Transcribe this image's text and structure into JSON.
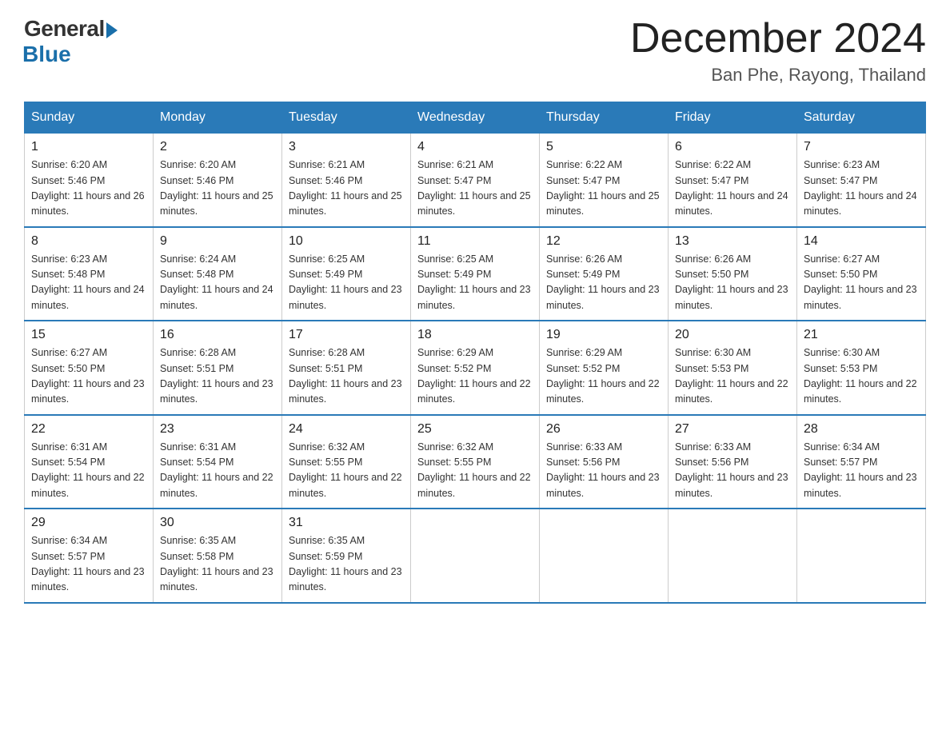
{
  "logo": {
    "general": "General",
    "blue": "Blue"
  },
  "title": "December 2024",
  "location": "Ban Phe, Rayong, Thailand",
  "days_of_week": [
    "Sunday",
    "Monday",
    "Tuesday",
    "Wednesday",
    "Thursday",
    "Friday",
    "Saturday"
  ],
  "weeks": [
    [
      {
        "day": "1",
        "sunrise": "6:20 AM",
        "sunset": "5:46 PM",
        "daylight": "11 hours and 26 minutes."
      },
      {
        "day": "2",
        "sunrise": "6:20 AM",
        "sunset": "5:46 PM",
        "daylight": "11 hours and 25 minutes."
      },
      {
        "day": "3",
        "sunrise": "6:21 AM",
        "sunset": "5:46 PM",
        "daylight": "11 hours and 25 minutes."
      },
      {
        "day": "4",
        "sunrise": "6:21 AM",
        "sunset": "5:47 PM",
        "daylight": "11 hours and 25 minutes."
      },
      {
        "day": "5",
        "sunrise": "6:22 AM",
        "sunset": "5:47 PM",
        "daylight": "11 hours and 25 minutes."
      },
      {
        "day": "6",
        "sunrise": "6:22 AM",
        "sunset": "5:47 PM",
        "daylight": "11 hours and 24 minutes."
      },
      {
        "day": "7",
        "sunrise": "6:23 AM",
        "sunset": "5:47 PM",
        "daylight": "11 hours and 24 minutes."
      }
    ],
    [
      {
        "day": "8",
        "sunrise": "6:23 AM",
        "sunset": "5:48 PM",
        "daylight": "11 hours and 24 minutes."
      },
      {
        "day": "9",
        "sunrise": "6:24 AM",
        "sunset": "5:48 PM",
        "daylight": "11 hours and 24 minutes."
      },
      {
        "day": "10",
        "sunrise": "6:25 AM",
        "sunset": "5:49 PM",
        "daylight": "11 hours and 23 minutes."
      },
      {
        "day": "11",
        "sunrise": "6:25 AM",
        "sunset": "5:49 PM",
        "daylight": "11 hours and 23 minutes."
      },
      {
        "day": "12",
        "sunrise": "6:26 AM",
        "sunset": "5:49 PM",
        "daylight": "11 hours and 23 minutes."
      },
      {
        "day": "13",
        "sunrise": "6:26 AM",
        "sunset": "5:50 PM",
        "daylight": "11 hours and 23 minutes."
      },
      {
        "day": "14",
        "sunrise": "6:27 AM",
        "sunset": "5:50 PM",
        "daylight": "11 hours and 23 minutes."
      }
    ],
    [
      {
        "day": "15",
        "sunrise": "6:27 AM",
        "sunset": "5:50 PM",
        "daylight": "11 hours and 23 minutes."
      },
      {
        "day": "16",
        "sunrise": "6:28 AM",
        "sunset": "5:51 PM",
        "daylight": "11 hours and 23 minutes."
      },
      {
        "day": "17",
        "sunrise": "6:28 AM",
        "sunset": "5:51 PM",
        "daylight": "11 hours and 23 minutes."
      },
      {
        "day": "18",
        "sunrise": "6:29 AM",
        "sunset": "5:52 PM",
        "daylight": "11 hours and 22 minutes."
      },
      {
        "day": "19",
        "sunrise": "6:29 AM",
        "sunset": "5:52 PM",
        "daylight": "11 hours and 22 minutes."
      },
      {
        "day": "20",
        "sunrise": "6:30 AM",
        "sunset": "5:53 PM",
        "daylight": "11 hours and 22 minutes."
      },
      {
        "day": "21",
        "sunrise": "6:30 AM",
        "sunset": "5:53 PM",
        "daylight": "11 hours and 22 minutes."
      }
    ],
    [
      {
        "day": "22",
        "sunrise": "6:31 AM",
        "sunset": "5:54 PM",
        "daylight": "11 hours and 22 minutes."
      },
      {
        "day": "23",
        "sunrise": "6:31 AM",
        "sunset": "5:54 PM",
        "daylight": "11 hours and 22 minutes."
      },
      {
        "day": "24",
        "sunrise": "6:32 AM",
        "sunset": "5:55 PM",
        "daylight": "11 hours and 22 minutes."
      },
      {
        "day": "25",
        "sunrise": "6:32 AM",
        "sunset": "5:55 PM",
        "daylight": "11 hours and 22 minutes."
      },
      {
        "day": "26",
        "sunrise": "6:33 AM",
        "sunset": "5:56 PM",
        "daylight": "11 hours and 23 minutes."
      },
      {
        "day": "27",
        "sunrise": "6:33 AM",
        "sunset": "5:56 PM",
        "daylight": "11 hours and 23 minutes."
      },
      {
        "day": "28",
        "sunrise": "6:34 AM",
        "sunset": "5:57 PM",
        "daylight": "11 hours and 23 minutes."
      }
    ],
    [
      {
        "day": "29",
        "sunrise": "6:34 AM",
        "sunset": "5:57 PM",
        "daylight": "11 hours and 23 minutes."
      },
      {
        "day": "30",
        "sunrise": "6:35 AM",
        "sunset": "5:58 PM",
        "daylight": "11 hours and 23 minutes."
      },
      {
        "day": "31",
        "sunrise": "6:35 AM",
        "sunset": "5:59 PM",
        "daylight": "11 hours and 23 minutes."
      },
      null,
      null,
      null,
      null
    ]
  ]
}
